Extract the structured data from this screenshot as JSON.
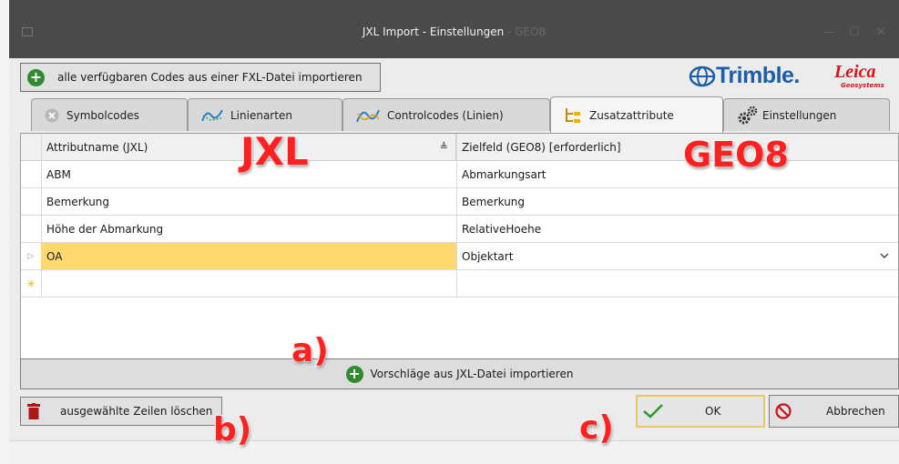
{
  "window": {
    "title_main": "JXL Import - Einstellungen",
    "title_faded": "- GEO8"
  },
  "toolbar": {
    "import_fxl_label": "alle verfügbaren Codes aus einer FXL-Datei importieren"
  },
  "logos": {
    "trimble": "Trimble.",
    "leica": "Leica",
    "leica_sub": "Geosystems"
  },
  "tabs": [
    {
      "label": "Symbolcodes",
      "icon": "circle-x-icon"
    },
    {
      "label": "Linienarten",
      "icon": "line-types-icon"
    },
    {
      "label": "Controlcodes (Linien)",
      "icon": "control-codes-icon"
    },
    {
      "label": "Zusatzattribute",
      "icon": "tree-attributes-icon",
      "active": true
    },
    {
      "label": "Einstellungen",
      "icon": "gears-icon"
    }
  ],
  "grid": {
    "columns": [
      "Attributname (JXL)",
      "Zielfeld (GEO8) [erforderlich]"
    ],
    "rows": [
      {
        "source": "ABM",
        "target": "Abmarkungsart"
      },
      {
        "source": "Bemerkung",
        "target": "Bemerkung"
      },
      {
        "source": "Höhe der Abmarkung",
        "target": "RelativeHoehe"
      },
      {
        "source": "OA",
        "target": "Objektart",
        "selected": true
      }
    ],
    "selected_highlight": "#ffd970"
  },
  "import_suggestions_label": "Vorschläge aus JXL-Datei importieren",
  "delete_rows_label": "ausgewählte Zeilen löschen",
  "ok_label": "OK",
  "cancel_label": "Abbrechen",
  "annotations": {
    "jxl": "JXL",
    "geo8": "GEO8",
    "a": "a)",
    "b": "b)",
    "c": "c)"
  },
  "colors": {
    "accent_green": "#2e8b2e",
    "cancel_red": "#c0161b",
    "annotation_red": "#ff2020",
    "ok_border": "#e6c86a"
  }
}
